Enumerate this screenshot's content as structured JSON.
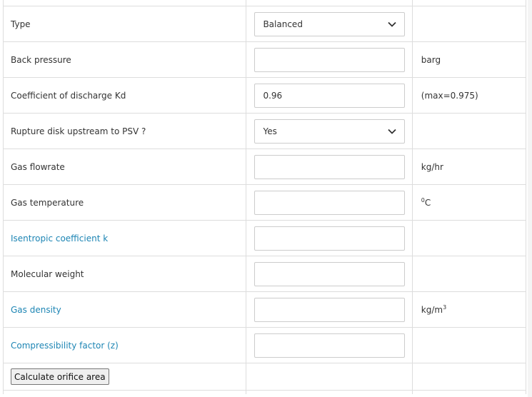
{
  "rows": [
    {
      "label": "Type",
      "control": "select",
      "value": "Balanced",
      "unit": ""
    },
    {
      "label": "Back pressure",
      "control": "input",
      "value": "",
      "unit": "barg"
    },
    {
      "label": "Coefficient of discharge Kd",
      "control": "input",
      "value": "0.96",
      "unit": "(max=0.975)"
    },
    {
      "label": "Rupture disk upstream to PSV ?",
      "control": "select",
      "value": "Yes",
      "unit": ""
    },
    {
      "label": "Gas flowrate",
      "control": "input",
      "value": "",
      "unit": "kg/hr"
    },
    {
      "label": "Gas temperature",
      "control": "input",
      "value": "",
      "unit_base": "C",
      "unit_sup": "0"
    },
    {
      "label": "Isentropic coefficient k",
      "control": "input",
      "value": "",
      "unit": "",
      "link": true
    },
    {
      "label": "Molecular weight",
      "control": "input",
      "value": "",
      "unit": ""
    },
    {
      "label": "Gas density",
      "control": "input",
      "value": "",
      "unit_base": "kg/m",
      "unit_sup": "3",
      "link": true
    },
    {
      "label": "Compressibility factor (z)",
      "control": "input",
      "value": "",
      "unit": "",
      "link": true
    }
  ],
  "actions": {
    "calculate_label": "Calculate orifice area"
  },
  "colors": {
    "link": "#1d85b4",
    "text": "#333333",
    "border": "#dddddd"
  }
}
